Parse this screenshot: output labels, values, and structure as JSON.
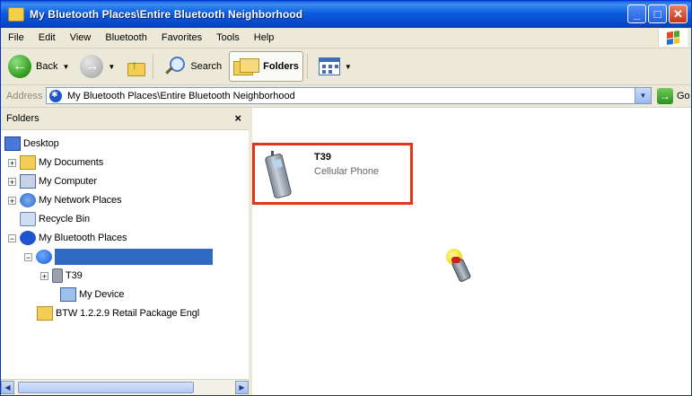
{
  "window": {
    "title": "My Bluetooth Places\\Entire Bluetooth Neighborhood",
    "buttons": {
      "minimize": "_",
      "maximize": "□",
      "close": "✕"
    }
  },
  "menu": [
    "File",
    "Edit",
    "View",
    "Bluetooth",
    "Favorites",
    "Tools",
    "Help"
  ],
  "toolbar": {
    "back": "Back",
    "search": "Search",
    "folders": "Folders"
  },
  "address": {
    "label": "Address",
    "value": "My Bluetooth Places\\Entire Bluetooth Neighborhood",
    "go": "Go"
  },
  "folders_pane": {
    "title": "Folders",
    "close": "×",
    "tree": [
      {
        "label": "Desktop",
        "icon": "desktop-icon"
      },
      {
        "label": "My Documents",
        "icon": "documents-folder-icon"
      },
      {
        "label": "My Computer",
        "icon": "computer-icon"
      },
      {
        "label": "My Network Places",
        "icon": "network-icon"
      },
      {
        "label": "Recycle Bin",
        "icon": "recycle-bin-icon"
      },
      {
        "label": "My Bluetooth Places",
        "icon": "bluetooth-icon"
      },
      {
        "label": "",
        "icon": "bluetooth-neighborhood-icon"
      },
      {
        "label": "T39",
        "icon": "phone-icon"
      },
      {
        "label": "My Device",
        "icon": "device-icon"
      },
      {
        "label": "BTW 1.2.2.9 Retail Package Engl",
        "icon": "folder-icon"
      }
    ]
  },
  "content": {
    "items": [
      {
        "name": "T39",
        "type": "Cellular Phone",
        "icon": "cellular-phone-icon"
      }
    ]
  },
  "colors": {
    "title_bar": "#0b5ee0",
    "selection": "#316ac5",
    "highlight_box": "#e2351b",
    "chrome": "#ece9d8"
  }
}
